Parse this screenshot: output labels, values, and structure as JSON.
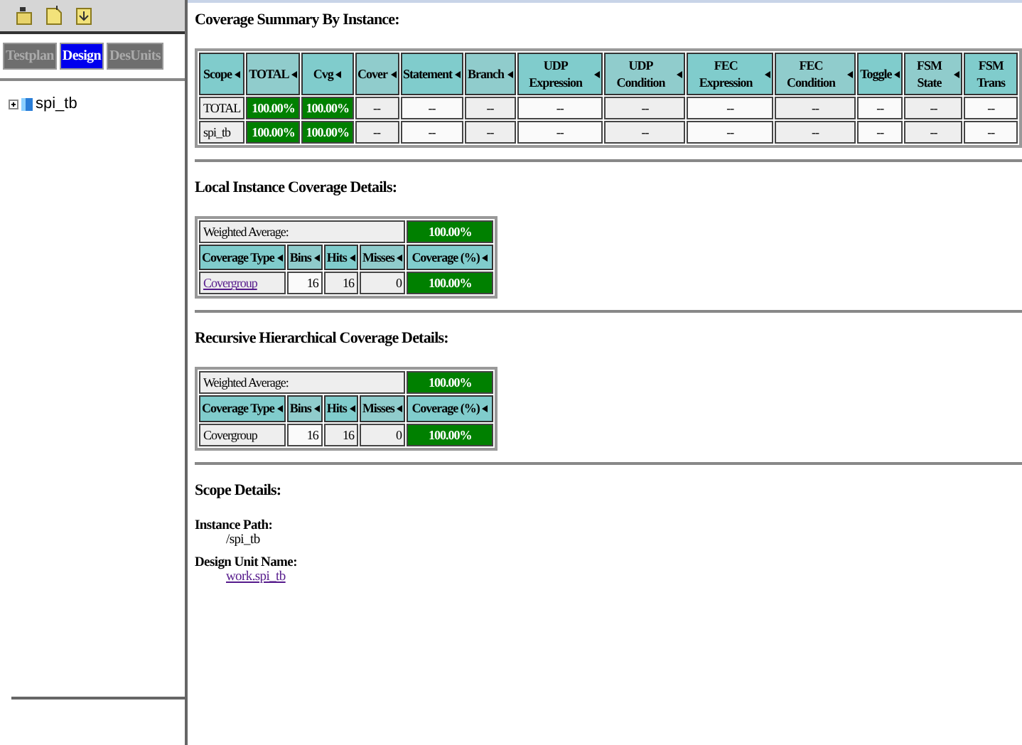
{
  "left_panel": {
    "tabs": [
      {
        "label": "Testplan",
        "selected": false
      },
      {
        "label": "Design",
        "selected": true
      },
      {
        "label": "DesUnits",
        "selected": false
      }
    ],
    "tree": [
      {
        "label": "spi_tb",
        "expanded": false
      }
    ]
  },
  "summary": {
    "title": "Coverage Summary By Instance:",
    "columns": [
      {
        "label": "Scope",
        "sort": true
      },
      {
        "label": "TOTAL",
        "sort": true
      },
      {
        "label": "Cvg",
        "sort": true
      },
      {
        "label": "Cover",
        "sort": true
      },
      {
        "label": "Statement",
        "sort": true
      },
      {
        "label": "Branch",
        "sort": true
      },
      {
        "label": "UDP Expression",
        "sort": true
      },
      {
        "label": "UDP Condition",
        "sort": true
      },
      {
        "label": "FEC Expression",
        "sort": true
      },
      {
        "label": "FEC Condition",
        "sort": true
      },
      {
        "label": "Toggle",
        "sort": true
      },
      {
        "label": "FSM State",
        "sort": true
      },
      {
        "label": "FSM Trans",
        "sort": false
      }
    ],
    "rows": [
      {
        "cells": [
          {
            "text": "TOTAL",
            "kind": "name"
          },
          {
            "text": "100.00%",
            "kind": "pct"
          },
          {
            "text": "100.00%",
            "kind": "pct"
          },
          {
            "text": "--",
            "kind": "dash"
          },
          {
            "text": "--",
            "kind": "dash"
          },
          {
            "text": "--",
            "kind": "dash"
          },
          {
            "text": "--",
            "kind": "dash"
          },
          {
            "text": "--",
            "kind": "dash"
          },
          {
            "text": "--",
            "kind": "dash"
          },
          {
            "text": "--",
            "kind": "dash"
          },
          {
            "text": "--",
            "kind": "dash"
          },
          {
            "text": "--",
            "kind": "dash"
          },
          {
            "text": "--",
            "kind": "dash"
          }
        ]
      },
      {
        "cells": [
          {
            "text": "spi_tb",
            "kind": "name"
          },
          {
            "text": "100.00%",
            "kind": "pct"
          },
          {
            "text": "100.00%",
            "kind": "pct"
          },
          {
            "text": "--",
            "kind": "dash"
          },
          {
            "text": "--",
            "kind": "dash"
          },
          {
            "text": "--",
            "kind": "dash"
          },
          {
            "text": "--",
            "kind": "dash"
          },
          {
            "text": "--",
            "kind": "dash"
          },
          {
            "text": "--",
            "kind": "dash"
          },
          {
            "text": "--",
            "kind": "dash"
          },
          {
            "text": "--",
            "kind": "dash"
          },
          {
            "text": "--",
            "kind": "dash"
          },
          {
            "text": "--",
            "kind": "dash"
          }
        ]
      }
    ]
  },
  "details": [
    {
      "title": "Local Instance Coverage Details:",
      "weighted_label": "Weighted Average:",
      "weighted_value": "100.00%",
      "columns": [
        "Coverage Type",
        "Bins",
        "Hits",
        "Misses",
        "Coverage (%)"
      ],
      "rows": [
        {
          "type": "Covergroup",
          "link": true,
          "bins": "16",
          "hits": "16",
          "misses": "0",
          "coverage": "100.00%"
        }
      ]
    },
    {
      "title": "Recursive Hierarchical Coverage Details:",
      "weighted_label": "Weighted Average:",
      "weighted_value": "100.00%",
      "columns": [
        "Coverage Type",
        "Bins",
        "Hits",
        "Misses",
        "Coverage (%)"
      ],
      "rows": [
        {
          "type": "Covergroup",
          "link": false,
          "bins": "16",
          "hits": "16",
          "misses": "0",
          "coverage": "100.00%"
        }
      ]
    }
  ],
  "scope": {
    "title": "Scope Details:",
    "fields": [
      {
        "label": "Instance Path:",
        "value": "/spi_tb",
        "link": false
      },
      {
        "label": "Design Unit Name:",
        "value": "work.spi_tb",
        "link": true
      }
    ]
  }
}
